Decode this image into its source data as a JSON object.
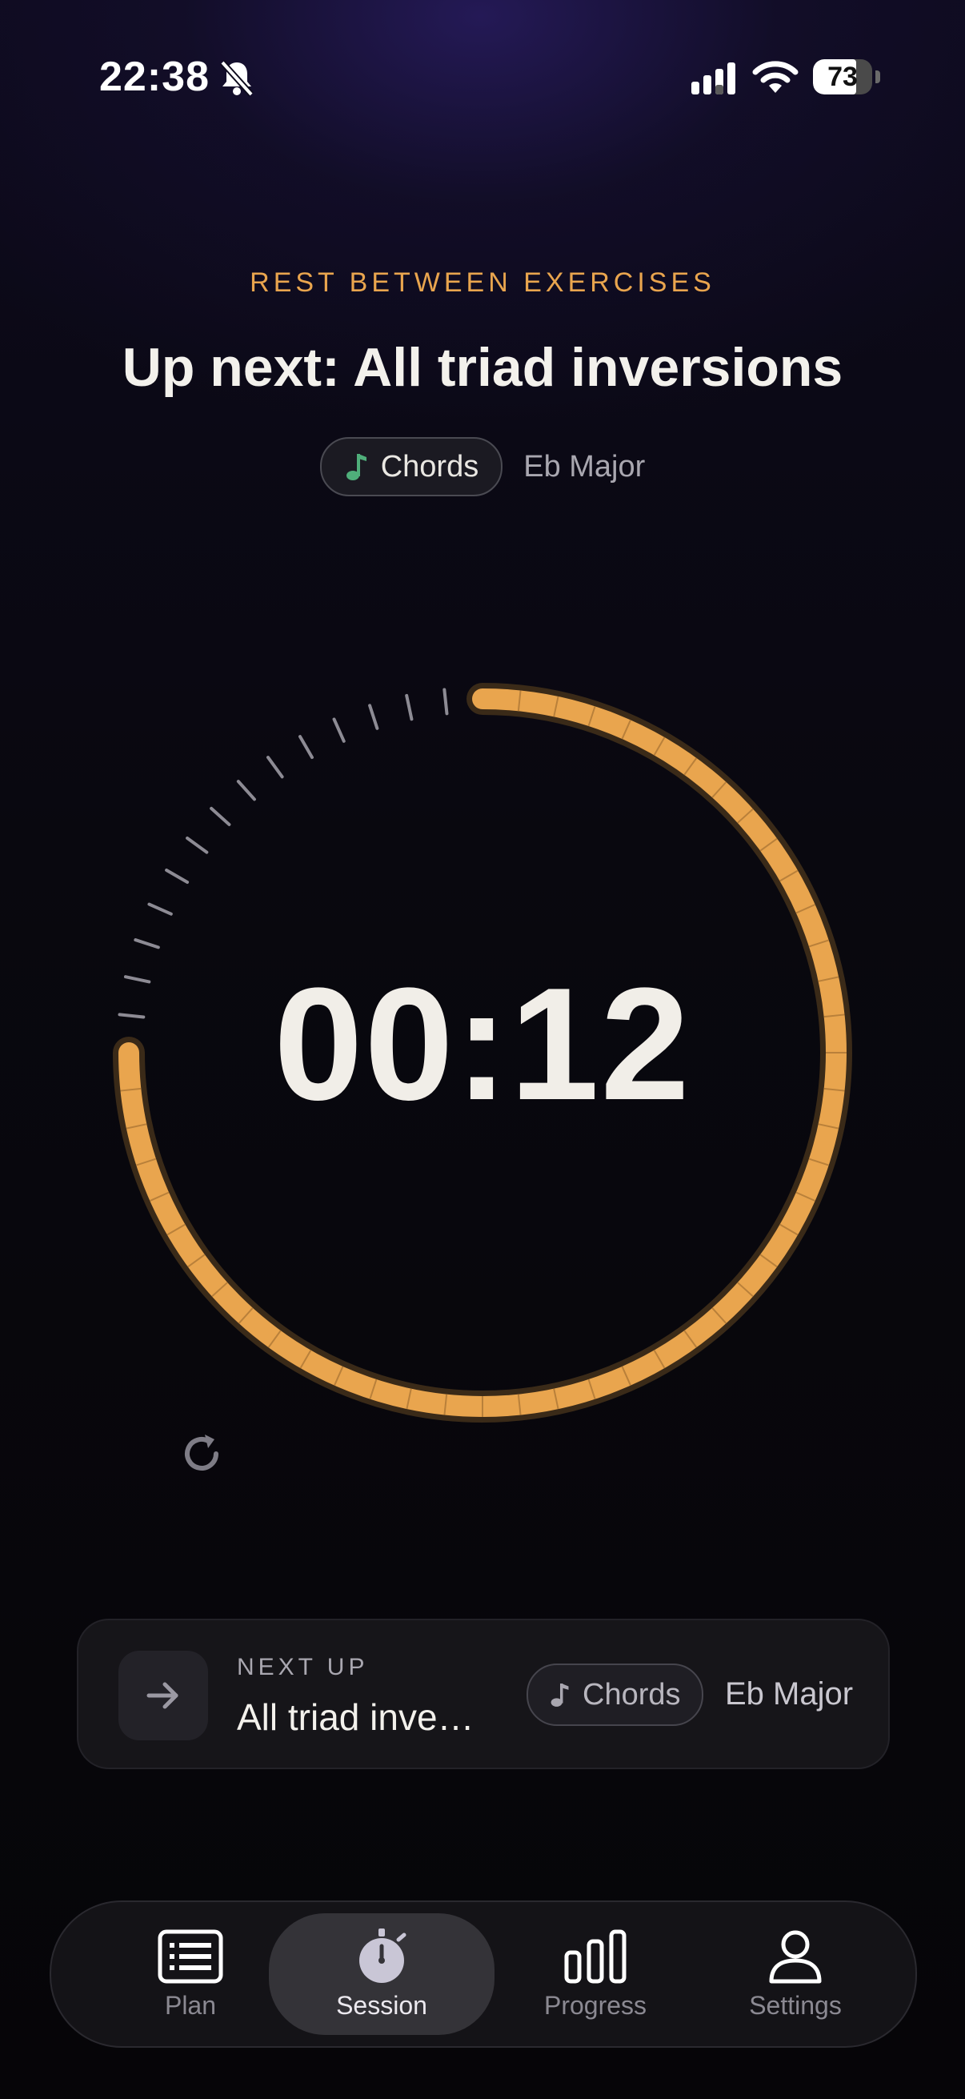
{
  "status_bar": {
    "time": "22:38",
    "battery_level": "73",
    "icons": [
      "bell-slash-icon",
      "cellular-signal-icon",
      "wifi-icon",
      "battery-icon"
    ]
  },
  "rest": {
    "eyebrow": "REST BETWEEN EXERCISES",
    "title": "Up next: All triad inversions",
    "category": "Chords",
    "key": "Eb Major",
    "category_icon": "music-note-icon"
  },
  "timer": {
    "display": "00:12",
    "remaining_fraction": 0.75,
    "accent_color": "#e9a54e",
    "reset_icon": "reset-icon"
  },
  "next_up": {
    "eyebrow": "NEXT UP",
    "title": "All triad inve…",
    "category": "Chords",
    "key": "Eb Major",
    "icon": "arrow-right-icon"
  },
  "tabs": [
    {
      "label": "Plan",
      "icon": "list-icon",
      "active": false
    },
    {
      "label": "Session",
      "icon": "stopwatch-icon",
      "active": true
    },
    {
      "label": "Progress",
      "icon": "bar-chart-icon",
      "active": false
    },
    {
      "label": "Settings",
      "icon": "person-icon",
      "active": false
    }
  ]
}
